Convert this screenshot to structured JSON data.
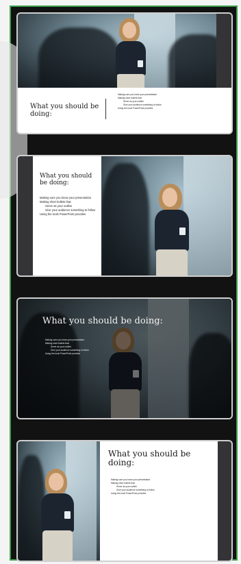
{
  "slides": [
    {
      "title": "What you should be doing:",
      "bullets": [
        "Making sure you know your presentation",
        "Making short bullets that:",
        "Serve as your outline",
        "Give your audience something to follow",
        "Using the tools PowerPoint provides"
      ]
    },
    {
      "title": "What you should be doing:",
      "bullets": [
        "Making sure you know your presentation",
        "Making short bullets that:",
        "Serve as your outline",
        "Give your audience something to follow",
        "Using the tools PowerPoint provides"
      ]
    },
    {
      "title": "What you should be doing:",
      "bullets": [
        "Making sure you know your presentation",
        "Making short bullets that:",
        "Serve as your outline",
        "Give your audience something to follow",
        "Using the tools PowerPoint provides"
      ]
    },
    {
      "title": "What you should be doing:",
      "bullets": [
        "Making sure you know your presentation",
        "Making short bullets that:",
        "Serve as your outline",
        "Give your audience something to follow",
        "Using the tools PowerPoint provides"
      ]
    }
  ],
  "colors": {
    "panel_border": "#3fa14b",
    "thumb_border": "#cfcfcf",
    "panel_bg": "#121212"
  }
}
